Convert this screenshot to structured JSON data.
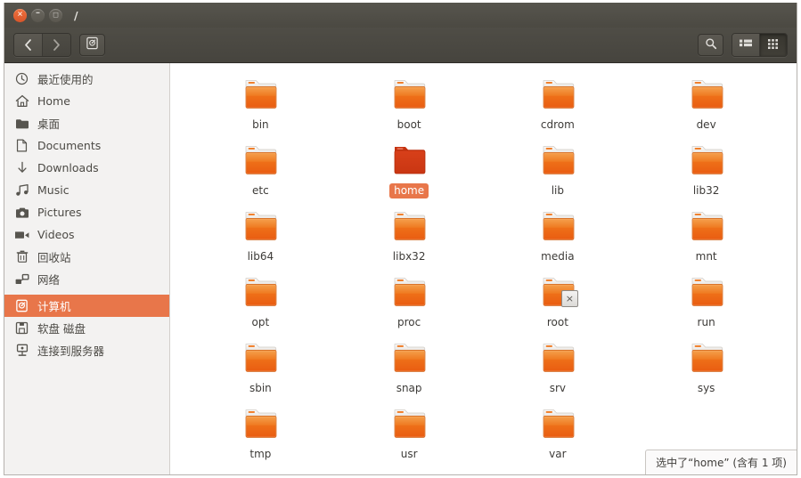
{
  "window": {
    "title": "/",
    "controls": [
      {
        "name": "close",
        "glyph": "✕"
      },
      {
        "name": "minimize",
        "glyph": "–"
      },
      {
        "name": "maximize",
        "glyph": "□"
      }
    ]
  },
  "toolbar": {
    "back_label": "‹",
    "forward_label": "›",
    "location_button_name": "computer-location-button",
    "search_name": "search-icon",
    "list_view_name": "list-view-icon",
    "grid_view_name": "grid-view-icon",
    "active_view": "grid"
  },
  "sidebar": {
    "items": [
      {
        "label": "最近使用的",
        "icon": "clock-icon",
        "selected": false
      },
      {
        "label": "Home",
        "icon": "home-icon",
        "selected": false
      },
      {
        "label": "桌面",
        "icon": "folder-icon",
        "selected": false
      },
      {
        "label": "Documents",
        "icon": "document-icon",
        "selected": false
      },
      {
        "label": "Downloads",
        "icon": "download-icon",
        "selected": false
      },
      {
        "label": "Music",
        "icon": "music-icon",
        "selected": false
      },
      {
        "label": "Pictures",
        "icon": "camera-icon",
        "selected": false
      },
      {
        "label": "Videos",
        "icon": "video-icon",
        "selected": false
      },
      {
        "label": "回收站",
        "icon": "trash-icon",
        "selected": false
      },
      {
        "label": "网络",
        "icon": "network-icon",
        "selected": false
      },
      {
        "label": "计算机",
        "icon": "computer-icon",
        "selected": true
      },
      {
        "label": "软盘 磁盘",
        "icon": "floppy-icon",
        "selected": false
      },
      {
        "label": "连接到服务器",
        "icon": "server-icon",
        "selected": false
      }
    ],
    "separator_after_index": 9
  },
  "files": [
    {
      "name": "bin",
      "selected": false,
      "badge": null
    },
    {
      "name": "boot",
      "selected": false,
      "badge": null
    },
    {
      "name": "cdrom",
      "selected": false,
      "badge": null
    },
    {
      "name": "dev",
      "selected": false,
      "badge": null
    },
    {
      "name": "etc",
      "selected": false,
      "badge": null
    },
    {
      "name": "home",
      "selected": true,
      "badge": null
    },
    {
      "name": "lib",
      "selected": false,
      "badge": null
    },
    {
      "name": "lib32",
      "selected": false,
      "badge": null
    },
    {
      "name": "lib64",
      "selected": false,
      "badge": null
    },
    {
      "name": "libx32",
      "selected": false,
      "badge": null
    },
    {
      "name": "media",
      "selected": false,
      "badge": null
    },
    {
      "name": "mnt",
      "selected": false,
      "badge": null
    },
    {
      "name": "opt",
      "selected": false,
      "badge": null
    },
    {
      "name": "proc",
      "selected": false,
      "badge": null
    },
    {
      "name": "root",
      "selected": false,
      "badge": "×"
    },
    {
      "name": "run",
      "selected": false,
      "badge": null
    },
    {
      "name": "sbin",
      "selected": false,
      "badge": null
    },
    {
      "name": "snap",
      "selected": false,
      "badge": null
    },
    {
      "name": "srv",
      "selected": false,
      "badge": null
    },
    {
      "name": "sys",
      "selected": false,
      "badge": null
    },
    {
      "name": "tmp",
      "selected": false,
      "badge": null
    },
    {
      "name": "usr",
      "selected": false,
      "badge": null
    },
    {
      "name": "var",
      "selected": false,
      "badge": null
    }
  ],
  "statusbar": {
    "text": "选中了“home” (含有 1 项)"
  },
  "colors": {
    "titlebar": "#4b4942",
    "toolbar": "#4a4841",
    "sidebar_bg": "#f3f2f1",
    "accent": "#e8764a",
    "folder_orange": "#ef7322",
    "folder_selected": "#d93f16",
    "close_button": "#e0602f"
  }
}
